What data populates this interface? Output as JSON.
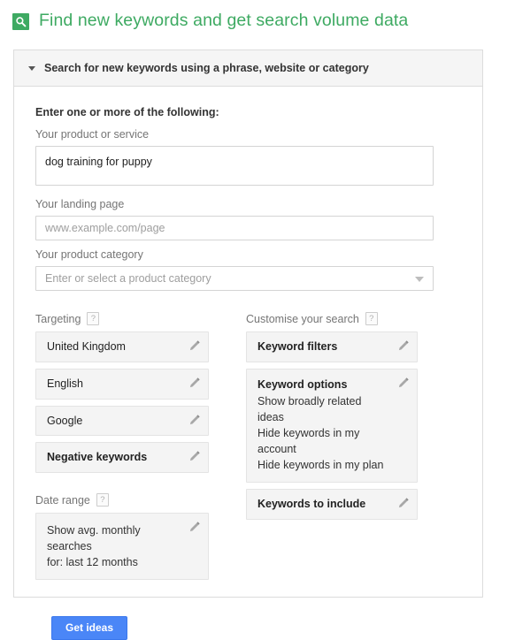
{
  "header": {
    "icon": "search-icon",
    "icon_color": "#3eaa62",
    "title": "Find new keywords and get search volume data"
  },
  "panel": {
    "collapse_caret": "caret-down-icon",
    "header_label": "Search for new keywords using a phrase, website or category"
  },
  "form": {
    "heading": "Enter one or more of the following:",
    "product_or_service": {
      "label": "Your product or service",
      "value": "dog training for puppy",
      "placeholder": ""
    },
    "landing_page": {
      "label": "Your landing page",
      "value": "",
      "placeholder": "www.example.com/page"
    },
    "product_category": {
      "label": "Your product category",
      "value": "Enter or select a product category",
      "arrow_icon": "chevron-down-icon"
    }
  },
  "targeting": {
    "label": "Targeting",
    "help": "?",
    "tiles": [
      {
        "title": "United Kingdom",
        "bold": false,
        "lines": []
      },
      {
        "title": "English",
        "bold": false,
        "lines": []
      },
      {
        "title": "Google",
        "bold": false,
        "lines": []
      },
      {
        "title": "Negative keywords",
        "bold": true,
        "lines": []
      }
    ]
  },
  "date_range": {
    "label": "Date range",
    "help": "?",
    "tile": {
      "title": "",
      "lines": [
        "Show avg. monthly searches",
        "for: last 12 months"
      ]
    }
  },
  "customise": {
    "label": "Customise your search",
    "help": "?",
    "tiles": [
      {
        "title": "Keyword filters",
        "bold": true,
        "lines": []
      },
      {
        "title": "Keyword options",
        "bold": true,
        "lines": [
          "Show broadly related ideas",
          "Hide keywords in my account",
          "Hide keywords in my plan"
        ]
      },
      {
        "title": "Keywords to include",
        "bold": true,
        "lines": []
      }
    ]
  },
  "actions": {
    "get_ideas_label": "Get ideas",
    "get_ideas_color": "#4a86f7"
  },
  "icons": {
    "edit": "pencil-icon"
  }
}
